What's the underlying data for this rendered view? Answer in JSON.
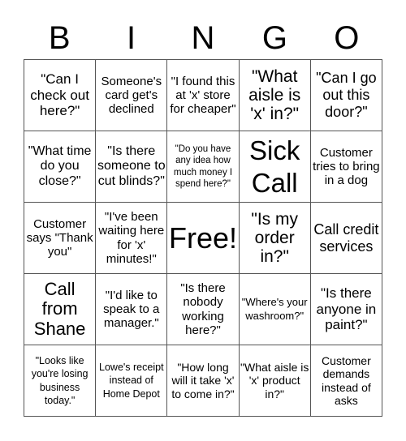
{
  "header": [
    "B",
    "I",
    "N",
    "G",
    "O"
  ],
  "cells": [
    "\"Can I check out here?\"",
    "Someone's card get's declined",
    "\"I found this at 'x' store for cheaper\"",
    "\"What aisle is 'x' in?\"",
    "\"Can I go out this door?\"",
    "\"What time do you close?\"",
    "\"Is there someone to cut blinds?\"",
    "\"Do you have any idea how much money I spend here?\"",
    "Sick Call",
    "Customer tries to bring in a dog",
    "Customer says \"Thank you\"",
    "\"I've been waiting here for 'x' minutes!\"",
    "Free!",
    "\"Is my order in?\"",
    "Call credit services",
    "Call from Shane",
    "\"I'd like to speak to a manager.\"",
    "\"Is there nobody working here?\"",
    "\"Where's your washroom?\"",
    "\"Is there anyone in paint?\"",
    "\"Looks like you're losing business today.\"",
    "Lowe's receipt instead of Home Depot",
    "\"How long will it take 'x' to come in?\"",
    "\"What aisle is 'x' product in?\"",
    "Customer demands instead of asks"
  ]
}
